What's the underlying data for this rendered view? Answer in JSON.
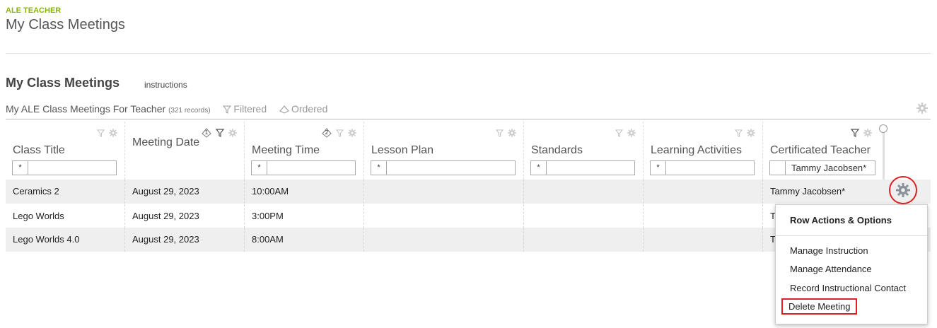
{
  "app": {
    "kicker": "ALE TEACHER",
    "title": "My Class Meetings"
  },
  "section": {
    "title": "My Class Meetings",
    "link": "instructions"
  },
  "list": {
    "name": "My ALE Class Meetings For Teacher",
    "count": "(321 records)",
    "filtered": "Filtered",
    "ordered": "Ordered"
  },
  "columns": [
    {
      "label": "Class Title",
      "filter_op": "*",
      "filter_value": ""
    },
    {
      "label": "Meeting Date",
      "sort_order": "1"
    },
    {
      "label": "Meeting Time",
      "sort_order": "2",
      "filter_op": "*",
      "filter_value": ""
    },
    {
      "label": "Lesson Plan",
      "filter_op": "*",
      "filter_value": ""
    },
    {
      "label": "Standards",
      "filter_op": "*",
      "filter_value": ""
    },
    {
      "label": "Learning Activities",
      "filter_op": "*",
      "filter_value": ""
    },
    {
      "label": "Certificated Teacher",
      "filter_op": "",
      "filter_value": "Tammy Jacobsen*"
    }
  ],
  "rows": [
    {
      "class_title": "Ceramics 2",
      "meeting_date": "August 29, 2023",
      "meeting_time": "10:00AM",
      "lesson_plan": "",
      "standards": "",
      "activities": "",
      "teacher": "Tammy Jacobsen*"
    },
    {
      "class_title": "Lego Worlds",
      "meeting_date": "August 29, 2023",
      "meeting_time": "3:00PM",
      "lesson_plan": "",
      "standards": "",
      "activities": "",
      "teacher": "Ta"
    },
    {
      "class_title": "Lego Worlds 4.0",
      "meeting_date": "August 29, 2023",
      "meeting_time": "8:00AM",
      "lesson_plan": "",
      "standards": "",
      "activities": "",
      "teacher": "Ta"
    }
  ],
  "menu": {
    "title": "Row Actions & Options",
    "items": [
      "Manage Instruction",
      "Manage Attendance",
      "Record Instructional Contact",
      "Delete Meeting"
    ]
  },
  "colors": {
    "accent": "#8bb400",
    "highlight": "#e02020"
  },
  "icons": [
    "filter-icon",
    "gear-icon",
    "sort-order-icon",
    "ordered-icon"
  ]
}
